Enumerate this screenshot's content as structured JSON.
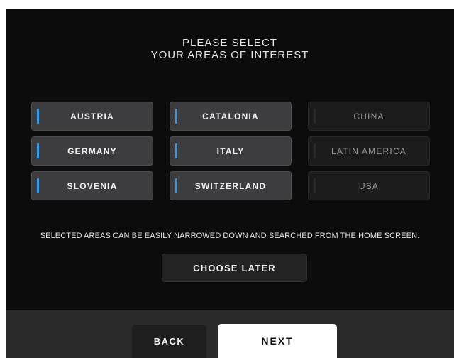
{
  "header": {
    "title_line1": "PLEASE SELECT",
    "title_line2": "YOUR AREAS OF INTEREST"
  },
  "areas": [
    {
      "label": "AUSTRIA",
      "selected": true
    },
    {
      "label": "CATALONIA",
      "selected": true
    },
    {
      "label": "CHINA",
      "selected": false
    },
    {
      "label": "GERMANY",
      "selected": true
    },
    {
      "label": "ITALY",
      "selected": true
    },
    {
      "label": "LATIN AMERICA",
      "selected": false
    },
    {
      "label": "SLOVENIA",
      "selected": true
    },
    {
      "label": "SWITZERLAND",
      "selected": true
    },
    {
      "label": "USA",
      "selected": false
    }
  ],
  "note": "SELECTED AREAS CAN BE EASILY NARROWED DOWN AND SEARCHED FROM THE HOME SCREEN.",
  "choose_later_label": "CHOOSE LATER",
  "footer": {
    "back_label": "BACK",
    "next_label": "NEXT"
  },
  "colors": {
    "accent": "#2f9bef",
    "background": "#0c0c0c",
    "footer": "#2a2a2b"
  }
}
